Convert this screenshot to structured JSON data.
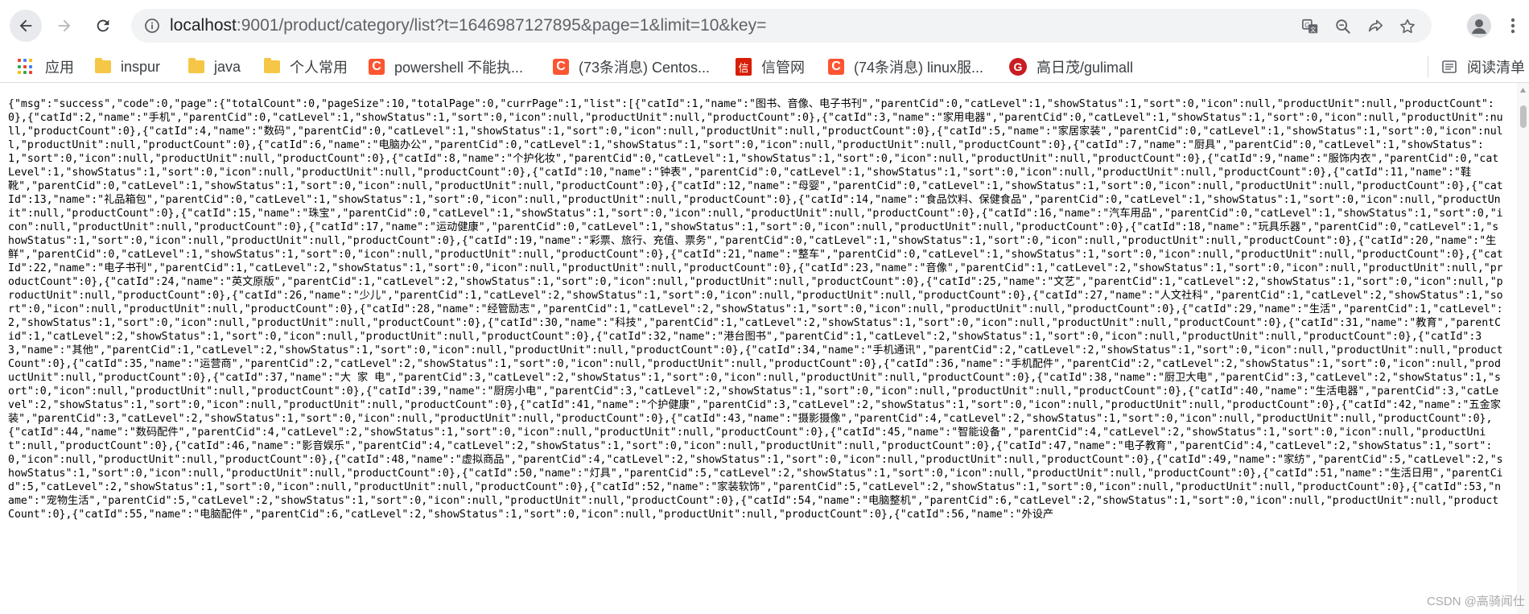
{
  "browser": {
    "url_host": "localhost",
    "url_rest": ":9001/product/category/list?t=1646987127895&page=1&limit=10&key="
  },
  "bookmarks": [
    {
      "label": "应用",
      "icon": "apps-grid-icon"
    },
    {
      "label": "inspur",
      "icon": "folder-icon"
    },
    {
      "label": "java",
      "icon": "folder-icon"
    },
    {
      "label": "个人常用",
      "icon": "folder-icon"
    },
    {
      "label": "powershell 不能执...",
      "icon": "csdn-icon"
    },
    {
      "label": "(73条消息) Centos...",
      "icon": "csdn-icon"
    },
    {
      "label": "信管网",
      "icon": "xinguan-icon"
    },
    {
      "label": "(74条消息) linux服...",
      "icon": "csdn-icon"
    },
    {
      "label": "高日茂/gulimall",
      "icon": "gitee-icon"
    }
  ],
  "reading_list": "阅读清单",
  "response_body": "{\"msg\":\"success\",\"code\":0,\"page\":{\"totalCount\":0,\"pageSize\":10,\"totalPage\":0,\"currPage\":1,\"list\":[{\"catId\":1,\"name\":\"图书、音像、电子书刊\",\"parentCid\":0,\"catLevel\":1,\"showStatus\":1,\"sort\":0,\"icon\":null,\"productUnit\":null,\"productCount\":0},{\"catId\":2,\"name\":\"手机\",\"parentCid\":0,\"catLevel\":1,\"showStatus\":1,\"sort\":0,\"icon\":null,\"productUnit\":null,\"productCount\":0},{\"catId\":3,\"name\":\"家用电器\",\"parentCid\":0,\"catLevel\":1,\"showStatus\":1,\"sort\":0,\"icon\":null,\"productUnit\":null,\"productCount\":0},{\"catId\":4,\"name\":\"数码\",\"parentCid\":0,\"catLevel\":1,\"showStatus\":1,\"sort\":0,\"icon\":null,\"productUnit\":null,\"productCount\":0},{\"catId\":5,\"name\":\"家居家装\",\"parentCid\":0,\"catLevel\":1,\"showStatus\":1,\"sort\":0,\"icon\":null,\"productUnit\":null,\"productCount\":0},{\"catId\":6,\"name\":\"电脑办公\",\"parentCid\":0,\"catLevel\":1,\"showStatus\":1,\"sort\":0,\"icon\":null,\"productUnit\":null,\"productCount\":0},{\"catId\":7,\"name\":\"厨具\",\"parentCid\":0,\"catLevel\":1,\"showStatus\":1,\"sort\":0,\"icon\":null,\"productUnit\":null,\"productCount\":0},{\"catId\":8,\"name\":\"个护化妆\",\"parentCid\":0,\"catLevel\":1,\"showStatus\":1,\"sort\":0,\"icon\":null,\"productUnit\":null,\"productCount\":0},{\"catId\":9,\"name\":\"服饰内衣\",\"parentCid\":0,\"catLevel\":1,\"showStatus\":1,\"sort\":0,\"icon\":null,\"productUnit\":null,\"productCount\":0},{\"catId\":10,\"name\":\"钟表\",\"parentCid\":0,\"catLevel\":1,\"showStatus\":1,\"sort\":0,\"icon\":null,\"productUnit\":null,\"productCount\":0},{\"catId\":11,\"name\":\"鞋靴\",\"parentCid\":0,\"catLevel\":1,\"showStatus\":1,\"sort\":0,\"icon\":null,\"productUnit\":null,\"productCount\":0},{\"catId\":12,\"name\":\"母婴\",\"parentCid\":0,\"catLevel\":1,\"showStatus\":1,\"sort\":0,\"icon\":null,\"productUnit\":null,\"productCount\":0},{\"catId\":13,\"name\":\"礼品箱包\",\"parentCid\":0,\"catLevel\":1,\"showStatus\":1,\"sort\":0,\"icon\":null,\"productUnit\":null,\"productCount\":0},{\"catId\":14,\"name\":\"食品饮料、保健食品\",\"parentCid\":0,\"catLevel\":1,\"showStatus\":1,\"sort\":0,\"icon\":null,\"productUnit\":null,\"productCount\":0},{\"catId\":15,\"name\":\"珠宝\",\"parentCid\":0,\"catLevel\":1,\"showStatus\":1,\"sort\":0,\"icon\":null,\"productUnit\":null,\"productCount\":0},{\"catId\":16,\"name\":\"汽车用品\",\"parentCid\":0,\"catLevel\":1,\"showStatus\":1,\"sort\":0,\"icon\":null,\"productUnit\":null,\"productCount\":0},{\"catId\":17,\"name\":\"运动健康\",\"parentCid\":0,\"catLevel\":1,\"showStatus\":1,\"sort\":0,\"icon\":null,\"productUnit\":null,\"productCount\":0},{\"catId\":18,\"name\":\"玩具乐器\",\"parentCid\":0,\"catLevel\":1,\"showStatus\":1,\"sort\":0,\"icon\":null,\"productUnit\":null,\"productCount\":0},{\"catId\":19,\"name\":\"彩票、旅行、充值、票务\",\"parentCid\":0,\"catLevel\":1,\"showStatus\":1,\"sort\":0,\"icon\":null,\"productUnit\":null,\"productCount\":0},{\"catId\":20,\"name\":\"生鲜\",\"parentCid\":0,\"catLevel\":1,\"showStatus\":1,\"sort\":0,\"icon\":null,\"productUnit\":null,\"productCount\":0},{\"catId\":21,\"name\":\"整车\",\"parentCid\":0,\"catLevel\":1,\"showStatus\":1,\"sort\":0,\"icon\":null,\"productUnit\":null,\"productCount\":0},{\"catId\":22,\"name\":\"电子书刊\",\"parentCid\":1,\"catLevel\":2,\"showStatus\":1,\"sort\":0,\"icon\":null,\"productUnit\":null,\"productCount\":0},{\"catId\":23,\"name\":\"音像\",\"parentCid\":1,\"catLevel\":2,\"showStatus\":1,\"sort\":0,\"icon\":null,\"productUnit\":null,\"productCount\":0},{\"catId\":24,\"name\":\"英文原版\",\"parentCid\":1,\"catLevel\":2,\"showStatus\":1,\"sort\":0,\"icon\":null,\"productUnit\":null,\"productCount\":0},{\"catId\":25,\"name\":\"文艺\",\"parentCid\":1,\"catLevel\":2,\"showStatus\":1,\"sort\":0,\"icon\":null,\"productUnit\":null,\"productCount\":0},{\"catId\":26,\"name\":\"少儿\",\"parentCid\":1,\"catLevel\":2,\"showStatus\":1,\"sort\":0,\"icon\":null,\"productUnit\":null,\"productCount\":0},{\"catId\":27,\"name\":\"人文社科\",\"parentCid\":1,\"catLevel\":2,\"showStatus\":1,\"sort\":0,\"icon\":null,\"productUnit\":null,\"productCount\":0},{\"catId\":28,\"name\":\"经管励志\",\"parentCid\":1,\"catLevel\":2,\"showStatus\":1,\"sort\":0,\"icon\":null,\"productUnit\":null,\"productCount\":0},{\"catId\":29,\"name\":\"生活\",\"parentCid\":1,\"catLevel\":2,\"showStatus\":1,\"sort\":0,\"icon\":null,\"productUnit\":null,\"productCount\":0},{\"catId\":30,\"name\":\"科技\",\"parentCid\":1,\"catLevel\":2,\"showStatus\":1,\"sort\":0,\"icon\":null,\"productUnit\":null,\"productCount\":0},{\"catId\":31,\"name\":\"教育\",\"parentCid\":1,\"catLevel\":2,\"showStatus\":1,\"sort\":0,\"icon\":null,\"productUnit\":null,\"productCount\":0},{\"catId\":32,\"name\":\"港台图书\",\"parentCid\":1,\"catLevel\":2,\"showStatus\":1,\"sort\":0,\"icon\":null,\"productUnit\":null,\"productCount\":0},{\"catId\":33,\"name\":\"其他\",\"parentCid\":1,\"catLevel\":2,\"showStatus\":1,\"sort\":0,\"icon\":null,\"productUnit\":null,\"productCount\":0},{\"catId\":34,\"name\":\"手机通讯\",\"parentCid\":2,\"catLevel\":2,\"showStatus\":1,\"sort\":0,\"icon\":null,\"productUnit\":null,\"productCount\":0},{\"catId\":35,\"name\":\"运营商\",\"parentCid\":2,\"catLevel\":2,\"showStatus\":1,\"sort\":0,\"icon\":null,\"productUnit\":null,\"productCount\":0},{\"catId\":36,\"name\":\"手机配件\",\"parentCid\":2,\"catLevel\":2,\"showStatus\":1,\"sort\":0,\"icon\":null,\"productUnit\":null,\"productCount\":0},{\"catId\":37,\"name\":\"大 家 电\",\"parentCid\":3,\"catLevel\":2,\"showStatus\":1,\"sort\":0,\"icon\":null,\"productUnit\":null,\"productCount\":0},{\"catId\":38,\"name\":\"厨卫大电\",\"parentCid\":3,\"catLevel\":2,\"showStatus\":1,\"sort\":0,\"icon\":null,\"productUnit\":null,\"productCount\":0},{\"catId\":39,\"name\":\"厨房小电\",\"parentCid\":3,\"catLevel\":2,\"showStatus\":1,\"sort\":0,\"icon\":null,\"productUnit\":null,\"productCount\":0},{\"catId\":40,\"name\":\"生活电器\",\"parentCid\":3,\"catLevel\":2,\"showStatus\":1,\"sort\":0,\"icon\":null,\"productUnit\":null,\"productCount\":0},{\"catId\":41,\"name\":\"个护健康\",\"parentCid\":3,\"catLevel\":2,\"showStatus\":1,\"sort\":0,\"icon\":null,\"productUnit\":null,\"productCount\":0},{\"catId\":42,\"name\":\"五金家装\",\"parentCid\":3,\"catLevel\":2,\"showStatus\":1,\"sort\":0,\"icon\":null,\"productUnit\":null,\"productCount\":0},{\"catId\":43,\"name\":\"摄影摄像\",\"parentCid\":4,\"catLevel\":2,\"showStatus\":1,\"sort\":0,\"icon\":null,\"productUnit\":null,\"productCount\":0},{\"catId\":44,\"name\":\"数码配件\",\"parentCid\":4,\"catLevel\":2,\"showStatus\":1,\"sort\":0,\"icon\":null,\"productUnit\":null,\"productCount\":0},{\"catId\":45,\"name\":\"智能设备\",\"parentCid\":4,\"catLevel\":2,\"showStatus\":1,\"sort\":0,\"icon\":null,\"productUnit\":null,\"productCount\":0},{\"catId\":46,\"name\":\"影音娱乐\",\"parentCid\":4,\"catLevel\":2,\"showStatus\":1,\"sort\":0,\"icon\":null,\"productUnit\":null,\"productCount\":0},{\"catId\":47,\"name\":\"电子教育\",\"parentCid\":4,\"catLevel\":2,\"showStatus\":1,\"sort\":0,\"icon\":null,\"productUnit\":null,\"productCount\":0},{\"catId\":48,\"name\":\"虚拟商品\",\"parentCid\":4,\"catLevel\":2,\"showStatus\":1,\"sort\":0,\"icon\":null,\"productUnit\":null,\"productCount\":0},{\"catId\":49,\"name\":\"家纺\",\"parentCid\":5,\"catLevel\":2,\"showStatus\":1,\"sort\":0,\"icon\":null,\"productUnit\":null,\"productCount\":0},{\"catId\":50,\"name\":\"灯具\",\"parentCid\":5,\"catLevel\":2,\"showStatus\":1,\"sort\":0,\"icon\":null,\"productUnit\":null,\"productCount\":0},{\"catId\":51,\"name\":\"生活日用\",\"parentCid\":5,\"catLevel\":2,\"showStatus\":1,\"sort\":0,\"icon\":null,\"productUnit\":null,\"productCount\":0},{\"catId\":52,\"name\":\"家装软饰\",\"parentCid\":5,\"catLevel\":2,\"showStatus\":1,\"sort\":0,\"icon\":null,\"productUnit\":null,\"productCount\":0},{\"catId\":53,\"name\":\"宠物生活\",\"parentCid\":5,\"catLevel\":2,\"showStatus\":1,\"sort\":0,\"icon\":null,\"productUnit\":null,\"productCount\":0},{\"catId\":54,\"name\":\"电脑整机\",\"parentCid\":6,\"catLevel\":2,\"showStatus\":1,\"sort\":0,\"icon\":null,\"productUnit\":null,\"productCount\":0},{\"catId\":55,\"name\":\"电脑配件\",\"parentCid\":6,\"catLevel\":2,\"showStatus\":1,\"sort\":0,\"icon\":null,\"productUnit\":null,\"productCount\":0},{\"catId\":56,\"name\":\"外设产",
  "watermark": "CSDN @高骑闻仕",
  "colors": {
    "csdn": "#fc5531",
    "gitee": "#c71d23",
    "folder": "#f6c646",
    "omnibox_bg": "#f1f3f4"
  }
}
